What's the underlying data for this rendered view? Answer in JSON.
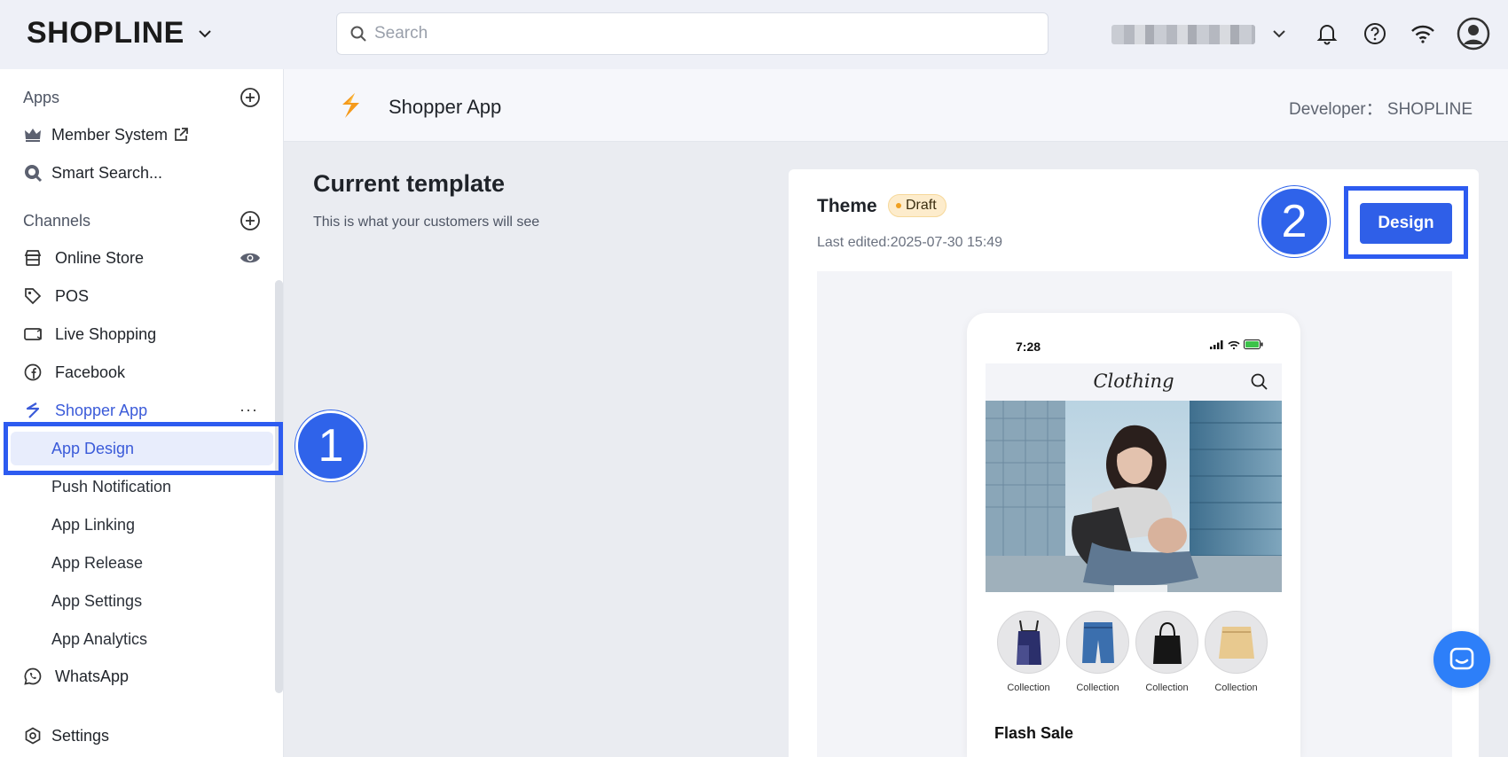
{
  "topbar": {
    "logo_text": "SHOPLINE",
    "search_placeholder": "Search",
    "icons": [
      "chevron-down-icon",
      "bell-icon",
      "help-icon",
      "wifi-icon",
      "avatar-icon"
    ]
  },
  "sidebar": {
    "apps_section": "Apps",
    "apps": [
      {
        "label": "Member System",
        "icon": "crown-icon"
      },
      {
        "label": "Smart Search...",
        "icon": "search-app-icon"
      }
    ],
    "channels_section": "Channels",
    "channels": [
      {
        "label": "Online Store",
        "icon": "store-icon"
      },
      {
        "label": "POS",
        "icon": "tag-icon"
      },
      {
        "label": "Live Shopping",
        "icon": "video-icon"
      },
      {
        "label": "Facebook",
        "icon": "facebook-icon"
      },
      {
        "label": "Shopper App",
        "icon": "shopper-app-icon"
      }
    ],
    "shopper_sub": [
      {
        "label": "App Design"
      },
      {
        "label": "Push Notification"
      },
      {
        "label": "App Linking"
      },
      {
        "label": "App Release"
      },
      {
        "label": "App Settings"
      },
      {
        "label": "App Analytics"
      }
    ],
    "whatsapp": "WhatsApp",
    "settings": "Settings",
    "more": "···"
  },
  "steps": {
    "one": "1",
    "two": "2"
  },
  "header": {
    "app_title": "Shopper App",
    "developer": "Developer： SHOPLINE"
  },
  "main": {
    "title": "Current template",
    "subtitle": "This is what your customers will see",
    "card": {
      "theme_label": "Theme",
      "status": "Draft",
      "last_edited": "Last edited:2025-07-30 15:49",
      "design_button": "Design"
    }
  },
  "phone": {
    "time": "7:28",
    "brand": "Clothing",
    "collections": [
      "Collection",
      "Collection",
      "Collection",
      "Collection"
    ],
    "section_title": "Flash Sale"
  },
  "colors": {
    "accent": "#2f5fe8",
    "highlight": "#2d5bf0",
    "draft_bg": "#fdeccc",
    "chat": "#2d7ff9"
  }
}
